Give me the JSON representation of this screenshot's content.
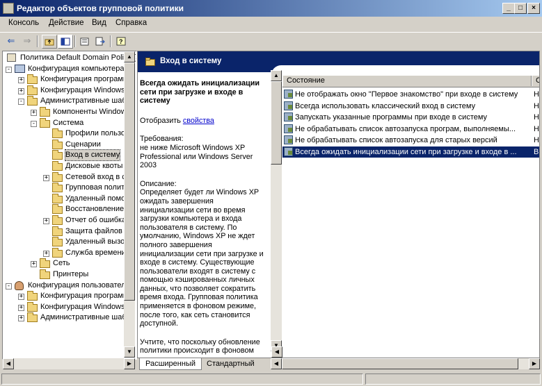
{
  "window": {
    "title": "Редактор объектов групповой политики",
    "controls": [
      "_",
      "□",
      "×"
    ]
  },
  "menu": [
    "Консоль",
    "Действие",
    "Вид",
    "Справка"
  ],
  "toolbar": {
    "icons": [
      "back-arrow-icon",
      "forward-arrow-icon",
      "up-folder-icon",
      "show-tree-icon",
      "properties-icon",
      "export-list-icon",
      "help-icon"
    ]
  },
  "tree": [
    {
      "label": "Политика Default Domain Policy [SE",
      "level": 0,
      "icon": "root",
      "exp": ""
    },
    {
      "label": "Конфигурация компьютера",
      "level": 0,
      "icon": "computer",
      "exp": "-"
    },
    {
      "label": "Конфигурация программ",
      "level": 1,
      "icon": "folder",
      "exp": "+"
    },
    {
      "label": "Конфигурация Windows",
      "level": 1,
      "icon": "folder",
      "exp": "+"
    },
    {
      "label": "Административные шабло",
      "level": 1,
      "icon": "folder",
      "exp": "-"
    },
    {
      "label": "Компоненты Windows",
      "level": 2,
      "icon": "folder",
      "exp": "+"
    },
    {
      "label": "Система",
      "level": 2,
      "icon": "folder",
      "exp": "-"
    },
    {
      "label": "Профили пользова",
      "level": 3,
      "icon": "folder",
      "exp": ""
    },
    {
      "label": "Сценарии",
      "level": 3,
      "icon": "folder",
      "exp": ""
    },
    {
      "label": "Вход в систему",
      "level": 3,
      "icon": "folder",
      "exp": "",
      "selected": true
    },
    {
      "label": "Дисковые квоты",
      "level": 3,
      "icon": "folder",
      "exp": ""
    },
    {
      "label": "Сетевой вход в си",
      "level": 3,
      "icon": "folder",
      "exp": "+"
    },
    {
      "label": "Групповая полити",
      "level": 3,
      "icon": "folder",
      "exp": ""
    },
    {
      "label": "Удаленный помощ",
      "level": 3,
      "icon": "folder",
      "exp": ""
    },
    {
      "label": "Восстановление си",
      "level": 3,
      "icon": "folder",
      "exp": ""
    },
    {
      "label": "Отчет об ошибках",
      "level": 3,
      "icon": "folder",
      "exp": "+"
    },
    {
      "label": "Защита файлов W",
      "level": 3,
      "icon": "folder",
      "exp": ""
    },
    {
      "label": "Удаленный вызов",
      "level": 3,
      "icon": "folder",
      "exp": ""
    },
    {
      "label": "Служба времени W",
      "level": 3,
      "icon": "folder",
      "exp": "+"
    },
    {
      "label": "Сеть",
      "level": 2,
      "icon": "folder",
      "exp": "+"
    },
    {
      "label": "Принтеры",
      "level": 2,
      "icon": "folder",
      "exp": ""
    },
    {
      "label": "Конфигурация пользователя",
      "level": 0,
      "icon": "user",
      "exp": "-"
    },
    {
      "label": "Конфигурация программ",
      "level": 1,
      "icon": "folder",
      "exp": "+"
    },
    {
      "label": "Конфигурация Windows",
      "level": 1,
      "icon": "folder",
      "exp": "+"
    },
    {
      "label": "Административные шабло",
      "level": 1,
      "icon": "folder",
      "exp": "+"
    }
  ],
  "banner": {
    "title": "Вход в систему"
  },
  "description": {
    "heading": "Всегда ожидать инициализации сети при загрузке и входе в систему",
    "show_label": "Отобразить",
    "show_link": "свойства",
    "requirements_label": "Требования:",
    "requirements_text": "не ниже Microsoft Windows XP Professional или Windows Server 2003",
    "description_label": "Описание:",
    "description_text": "Определяет будет ли Windows XP ожидать завершения инициализации сети во время загрузки компьютера и входа пользователя в систему. По умолчанию, Windows XP не ждет полного завершения инициализации сети при загрузке и входе в систему. Существующие пользователи входят в систему с помощью кэшированных личных данных, что позволяет сократить время входа. Групповая политика применяется в фоновом режиме, после того, как сеть становится доступной.",
    "note_text": "Учтите, что поскольку обновление политики происходит в фоновом режиме, для применения изменений"
  },
  "list": {
    "columns": [
      "Состояние",
      "С"
    ],
    "rows": [
      {
        "name": "Не отображать окно \"Первое знакомство\" при входе в систему",
        "state": "Н"
      },
      {
        "name": "Всегда использовать классический вход в систему",
        "state": "Н"
      },
      {
        "name": "Запускать указанные программы при входе в систему",
        "state": "Н"
      },
      {
        "name": "Не обрабатывать список автозапуска програм, выполняемы...",
        "state": "Н"
      },
      {
        "name": "Не обрабатывать список автозапуска для старых версий",
        "state": "Н"
      },
      {
        "name": "Всегда ожидать инициализации сети при загрузке и входе в ...",
        "state": "В",
        "selected": true
      }
    ]
  },
  "tabs": [
    "Расширенный",
    "Стандартный"
  ]
}
